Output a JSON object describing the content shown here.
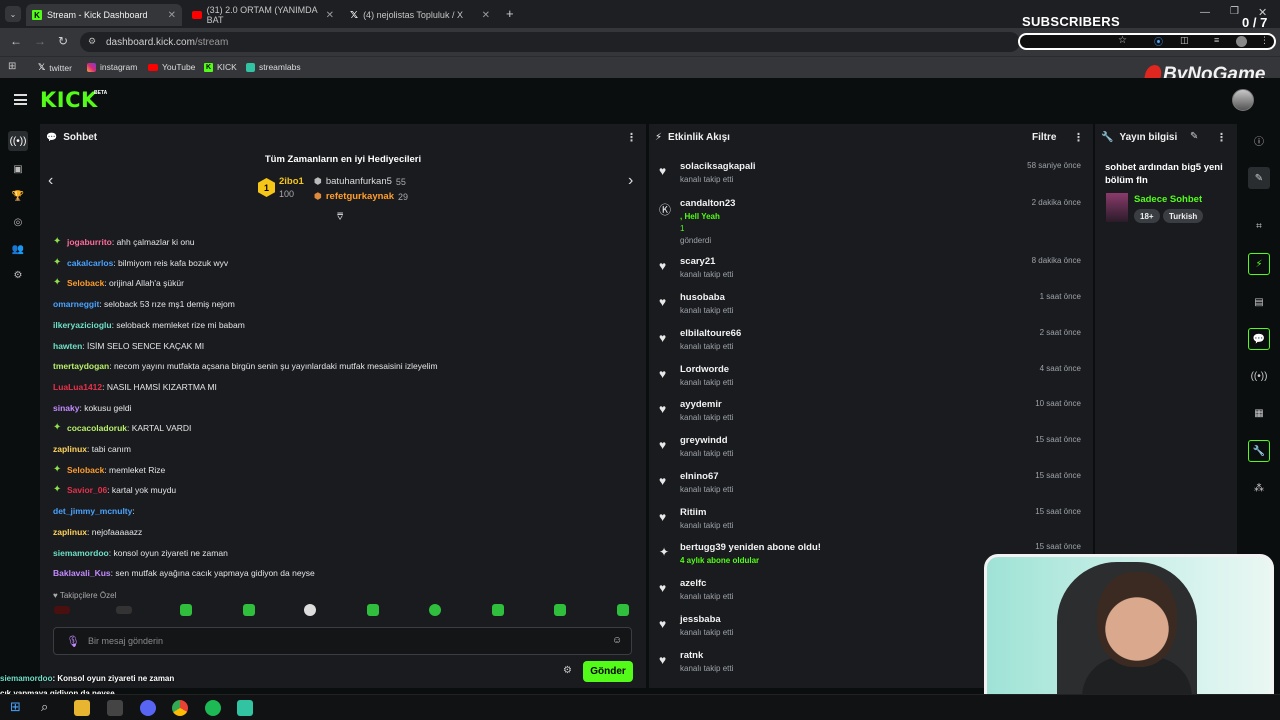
{
  "browser": {
    "tabs": [
      {
        "title": "Stream - Kick Dashboard",
        "icon": "kick-icon",
        "active": true
      },
      {
        "title": "(31) 2.0 ORTAM (YANIMDA BAT",
        "icon": "youtube-icon",
        "active": false
      },
      {
        "title": "(4) nejolistas Topluluk / X",
        "icon": "x-icon",
        "active": false
      }
    ],
    "url_host": "dashboard.kick.com",
    "url_path": "/stream",
    "bookmarks": [
      "twitter",
      "instagram",
      "YouTube",
      "KICK",
      "streamlabs"
    ]
  },
  "overlay": {
    "subscribers_title": "SUBSCRIBERS",
    "subscribers_count": "0 / 7",
    "brand": "ByNoGame",
    "bottom_line1_user": "siemamordoo",
    "bottom_line1_text": ": Konsol oyun ziyareti ne zaman",
    "bottom_line2_text": "cık yapmaya gidiyon da neyse"
  },
  "kick": {
    "logo": "KICK",
    "beta": "BETA"
  },
  "chat": {
    "title": "Sohbet",
    "gifters_title": "Tüm Zamanların en iyi Hediyecileri",
    "gifters": [
      {
        "rank": "1",
        "name": "2ibo1",
        "count": "100"
      },
      {
        "name": "batuhanfurkan5",
        "count": "55"
      },
      {
        "name": "refetgurkaynak",
        "count": "29"
      }
    ],
    "messages": [
      {
        "user": "jogaburrito",
        "color": "#ff6b9a",
        "text": ": ahh çalmazlar ki onu",
        "badge": true
      },
      {
        "user": "cakalcarlos",
        "color": "#4aa3ff",
        "text": ": bilmiyom reis kafa bozuk wyv",
        "badge": true
      },
      {
        "user": "Seloback",
        "color": "#ff9e2c",
        "text": ": orijinal Allah'a şükür",
        "badge": true
      },
      {
        "user": "omarneggit",
        "color": "#4aa3ff",
        "text": ": seloback 53 rıze mş1 demiş nejom",
        "badge": false
      },
      {
        "user": "ilkeryazicioglu",
        "color": "#6fe0c8",
        "text": ": seloback memleket rize mi babam",
        "badge": false
      },
      {
        "user": "hawten",
        "color": "#6fe0c8",
        "text": ": İSİM SELO SENCE KAÇAK MI",
        "badge": false
      },
      {
        "user": "tmertaydogan",
        "color": "#b8f06a",
        "text": ": necom yayını mutfakta açsana birgün senin şu yayınlardaki mutfak mesaisini izleyelim",
        "badge": false
      },
      {
        "user": "LuaLua1412",
        "color": "#e8314a",
        "text": ": NASIL HAMSİ KIZARTMA MI",
        "badge": false
      },
      {
        "user": "sinaky",
        "color": "#c58bff",
        "text": ": kokusu geldi",
        "badge": false
      },
      {
        "user": "cocacoladoruk",
        "color": "#b8f06a",
        "text": ": KARTAL VARDI",
        "badge": true
      },
      {
        "user": "zaplinux",
        "color": "#ffd35a",
        "text": ": tabi canım",
        "badge": false
      },
      {
        "user": "Seloback",
        "color": "#ff9e2c",
        "text": ": memleket Rize",
        "badge": true
      },
      {
        "user": "Savior_06",
        "color": "#e8314a",
        "text": ": kartal yok muydu",
        "badge": true
      },
      {
        "user": "det_jimmy_mcnulty",
        "color": "#4aa3ff",
        "text": ":",
        "badge": false
      },
      {
        "user": "zaplinux",
        "color": "#ffd35a",
        "text": ": nejofaaaaazz",
        "badge": false
      },
      {
        "user": "siemamordoo",
        "color": "#6fe0c8",
        "text": ": konsol oyun ziyareti ne zaman",
        "badge": false
      },
      {
        "user": "Baklavali_Kus",
        "color": "#c58bff",
        "text": ": sen mutfak ayağına cacık yapmaya gidiyon da neyse",
        "badge": false
      }
    ],
    "followers_special": "Takipçilere Özel",
    "input_placeholder": "Bir mesaj gönderin",
    "send_label": "Gönder"
  },
  "feed": {
    "title": "Etkinlik Akışı",
    "filter_label": "Filtre",
    "events": [
      {
        "name": "solaciksagkapali",
        "sub": "kanalı takip etti",
        "time": "58 saniye önce",
        "icon": "heart-icon"
      },
      {
        "name": "candalton23",
        "sub": ", Hell Yeah",
        "extra": "1",
        "sub2": "gönderdi",
        "time": "2 dakika önce",
        "icon": "kick-coin-icon"
      },
      {
        "name": "scary21",
        "sub": "kanalı takip etti",
        "time": "8 dakika önce",
        "icon": "heart-icon"
      },
      {
        "name": "husobaba",
        "sub": "kanalı takip etti",
        "time": "1 saat önce",
        "icon": "heart-icon"
      },
      {
        "name": "elbilaltoure66",
        "sub": "kanalı takip etti",
        "time": "2 saat önce",
        "icon": "heart-icon"
      },
      {
        "name": "Lordworde",
        "sub": "kanalı takip etti",
        "time": "4 saat önce",
        "icon": "heart-icon"
      },
      {
        "name": "ayydemir",
        "sub": "kanalı takip etti",
        "time": "10 saat önce",
        "icon": "heart-icon"
      },
      {
        "name": "greywindd",
        "sub": "kanalı takip etti",
        "time": "15 saat önce",
        "icon": "heart-icon"
      },
      {
        "name": "elnino67",
        "sub": "kanalı takip etti",
        "time": "15 saat önce",
        "icon": "heart-icon"
      },
      {
        "name": "Ritiim",
        "sub": "kanalı takip etti",
        "time": "15 saat önce",
        "icon": "heart-icon"
      },
      {
        "name": "bertugg39 yeniden abone oldu!",
        "sub": "4 aylık abone oldular",
        "time": "15 saat önce",
        "icon": "sparkle-icon"
      },
      {
        "name": "azelfc",
        "sub": "kanalı takip etti",
        "time": "",
        "icon": "heart-icon"
      },
      {
        "name": "jessbaba",
        "sub": "kanalı takip etti",
        "time": "",
        "icon": "heart-icon"
      },
      {
        "name": "ratnk",
        "sub": "kanalı takip etti",
        "time": "",
        "icon": "heart-icon"
      }
    ]
  },
  "stream_info": {
    "title": "Yayın bilgisi",
    "stream_title": "sohbet ardından big5 yeni bölüm fln",
    "category": "Sadece Sohbet",
    "tags": [
      "18+",
      "Turkish"
    ]
  },
  "colors": {
    "accent": "#53fc18",
    "panel": "#191b1f",
    "background": "#0b0e0f"
  }
}
